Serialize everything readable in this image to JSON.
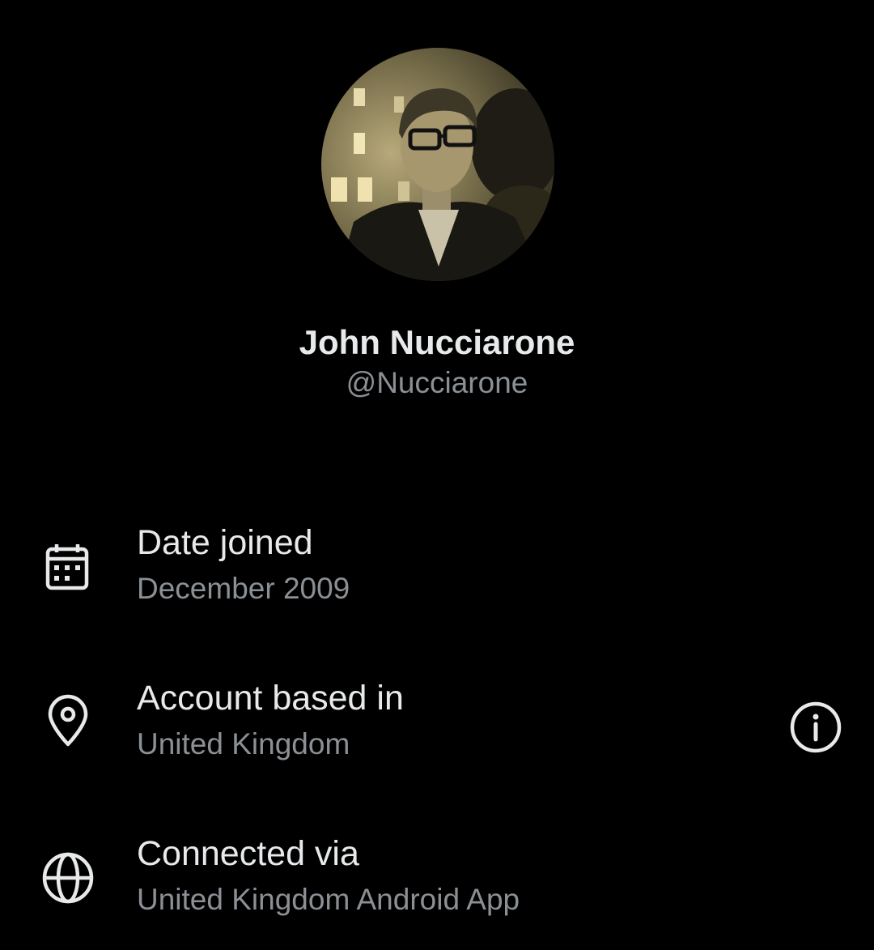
{
  "profile": {
    "display_name": "John Nucciarone",
    "handle": "@Nucciarone",
    "avatar_icon": "profile-photo"
  },
  "about": {
    "rows": [
      {
        "icon": "calendar-icon",
        "title": "Date joined",
        "value": "December 2009"
      },
      {
        "icon": "location-pin-icon",
        "title": "Account based in",
        "value": "United Kingdom",
        "action_icon": "info-icon"
      },
      {
        "icon": "globe-icon",
        "title": "Connected via",
        "value": "United Kingdom Android App"
      }
    ]
  },
  "colors": {
    "background": "#000000",
    "primary_text": "#e7e9ea",
    "secondary_text": "#8b9095",
    "icon": "#e7e9ea"
  }
}
